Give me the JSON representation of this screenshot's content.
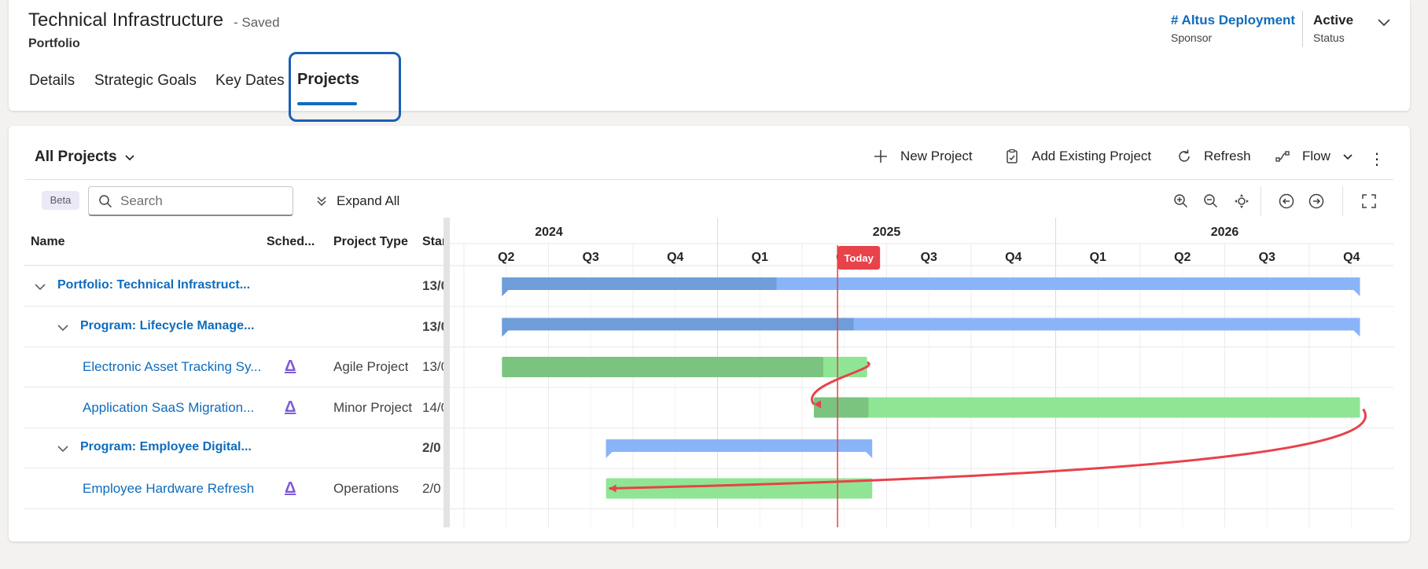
{
  "header": {
    "title": "Technical Infrastructure",
    "saved": "- Saved",
    "entity_type": "Portfolio",
    "tabs": [
      "Details",
      "Strategic Goals",
      "Key Dates",
      "Projects"
    ],
    "active_tab": "Projects",
    "sponsor": {
      "value": "# Altus Deployment",
      "label": "Sponsor"
    },
    "status": {
      "value": "Active",
      "label": "Status"
    }
  },
  "toolbar": {
    "view": "All Projects",
    "commands": [
      "New Project",
      "Add Existing Project",
      "Refresh",
      "Flow"
    ],
    "beta": "Beta",
    "search_placeholder": "Search",
    "expand_all": "Expand All"
  },
  "grid": {
    "columns": [
      "Name",
      "Sched...",
      "Project Type",
      "Star"
    ],
    "rows": [
      {
        "name": "Portfolio: Technical Infrastruct...",
        "level": 0,
        "kind": "portfolio",
        "sched": "",
        "type": "",
        "start": "13/0"
      },
      {
        "name": "Program: Lifecycle Manage...",
        "level": 1,
        "kind": "program",
        "sched": "",
        "type": "",
        "start": "13/0"
      },
      {
        "name": "Electronic Asset Tracking Sy...",
        "level": 2,
        "kind": "project",
        "sched": "agile",
        "type": "Agile Project",
        "start": "13/0"
      },
      {
        "name": "Application SaaS Migration...",
        "level": 2,
        "kind": "project",
        "sched": "agile",
        "type": "Minor Project",
        "start": "14/0"
      },
      {
        "name": "Program: Employee Digital...",
        "level": 1,
        "kind": "program",
        "sched": "",
        "type": "",
        "start": "2/0"
      },
      {
        "name": "Employee Hardware Refresh",
        "level": 2,
        "kind": "project",
        "sched": "agile",
        "type": "Operations",
        "start": "2/0"
      }
    ]
  },
  "timeline": {
    "years": [
      "2024",
      "2025",
      "2026"
    ],
    "quarters": [
      "Q2",
      "Q3",
      "Q4",
      "Q1",
      "Q2",
      "Q3",
      "Q4",
      "Q1",
      "Q2",
      "Q3",
      "Q4"
    ],
    "today_label": "Today",
    "today_quarter_index": 4.42,
    "colors": {
      "summary": "#8ab4f8",
      "summary_progress": "#6f9dd9",
      "task": "#90e595",
      "task_progress": "#7ac47f",
      "today": "#e8424a",
      "dependency": "#e8424a"
    },
    "bars": [
      {
        "row": 0,
        "kind": "summary",
        "start": 0.45,
        "end": 10.6,
        "progress": 0.32
      },
      {
        "row": 1,
        "kind": "summary",
        "start": 0.45,
        "end": 10.6,
        "progress": 0.41
      },
      {
        "row": 2,
        "kind": "task",
        "start": 0.45,
        "end": 4.77,
        "progress": 0.88
      },
      {
        "row": 3,
        "kind": "task",
        "start": 4.14,
        "end": 10.6,
        "progress": 0.1
      },
      {
        "row": 4,
        "kind": "summary",
        "start": 1.68,
        "end": 4.83,
        "progress": 0
      },
      {
        "row": 5,
        "kind": "task",
        "start": 1.68,
        "end": 4.83,
        "progress": 0
      }
    ],
    "dependencies": [
      {
        "from": 2,
        "to": 3
      },
      {
        "from": 3,
        "to": 5
      }
    ]
  }
}
